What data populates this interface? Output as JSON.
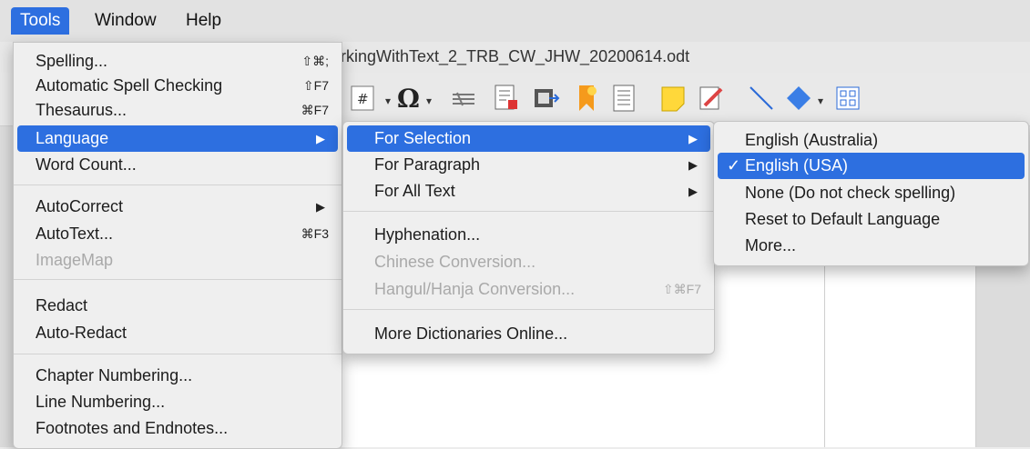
{
  "menubar": {
    "items": [
      "Tools",
      "Window",
      "Help"
    ]
  },
  "document": {
    "title": "rkingWithText_2_TRB_CW_JHW_20200614.odt"
  },
  "toolbar": {
    "icons": [
      "hash-icon",
      "omega-icon",
      "wrap-icon",
      "insert-doc-icon",
      "export-icon",
      "bookmark-icon",
      "list-icon",
      "note-icon",
      "edit-icon",
      "line-icon",
      "diamond-icon",
      "grid-icon"
    ]
  },
  "tools_menu": {
    "spelling": {
      "label": "Spelling...",
      "shortcut": "⇧⌘;"
    },
    "auto_spell": {
      "label": "Automatic Spell Checking",
      "shortcut": "⇧F7"
    },
    "thesaurus": {
      "label": "Thesaurus...",
      "shortcut": "⌘F7"
    },
    "language": {
      "label": "Language"
    },
    "word_count": {
      "label": "Word Count..."
    },
    "autocorrect": {
      "label": "AutoCorrect"
    },
    "autotext": {
      "label": "AutoText...",
      "shortcut": "⌘F3"
    },
    "imagemap": {
      "label": "ImageMap"
    },
    "redact": {
      "label": "Redact"
    },
    "auto_redact": {
      "label": "Auto-Redact"
    },
    "chapter_numbering": {
      "label": "Chapter Numbering..."
    },
    "line_numbering": {
      "label": "Line Numbering..."
    },
    "footnotes": {
      "label": "Footnotes and Endnotes..."
    }
  },
  "language_menu": {
    "for_selection": "For Selection",
    "for_paragraph": "For Paragraph",
    "for_all_text": "For All Text",
    "hyphenation": "Hyphenation...",
    "chinese_conversion": "Chinese Conversion...",
    "hangul_conversion": {
      "label": "Hangul/Hanja Conversion...",
      "shortcut": "⇧⌘F7"
    },
    "more_dictionaries": "More Dictionaries Online..."
  },
  "selection_menu": {
    "english_australia": "English (Australia)",
    "english_usa": "English (USA)",
    "check_mark": "✓",
    "none": "None (Do not check spelling)",
    "reset": "Reset to Default Language",
    "more": "More..."
  },
  "colors": {
    "accent": "#2d6fe0"
  }
}
